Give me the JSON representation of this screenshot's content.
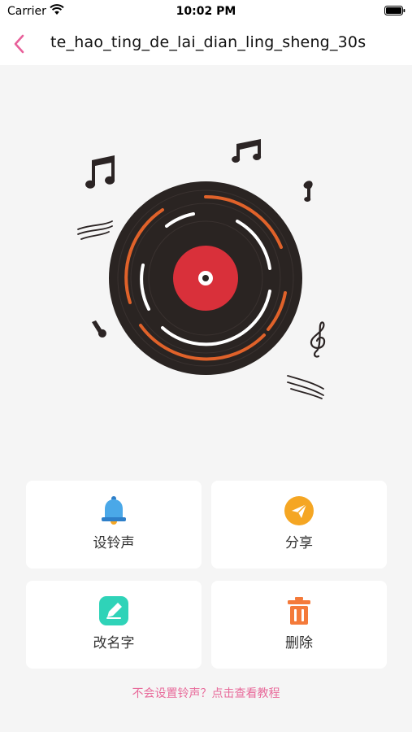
{
  "status_bar": {
    "carrier": "Carrier",
    "time": "10:02 PM",
    "wifi_icon": "wifi-icon",
    "battery_icon": "battery-icon"
  },
  "nav": {
    "back_icon": "chevron-left-icon",
    "title": "te_hao_ting_de_lai_dian_ling_sheng_30s",
    "accent_color": "#e8609a"
  },
  "record": {
    "icon": "vinyl-record",
    "label_color": "#d9303a",
    "groove_orange": "#e0622a",
    "disc_color": "#2a2422"
  },
  "actions": [
    {
      "label": "设铃声",
      "icon": "bell-icon",
      "color": "#4aa8e8"
    },
    {
      "label": "分享",
      "icon": "send-icon",
      "color": "#f5a623"
    },
    {
      "label": "改名字",
      "icon": "edit-icon",
      "color": "#2fd3b8"
    },
    {
      "label": "删除",
      "icon": "trash-icon",
      "color": "#f47a3a"
    }
  ],
  "help_link": "不会设置铃声？点击查看教程"
}
